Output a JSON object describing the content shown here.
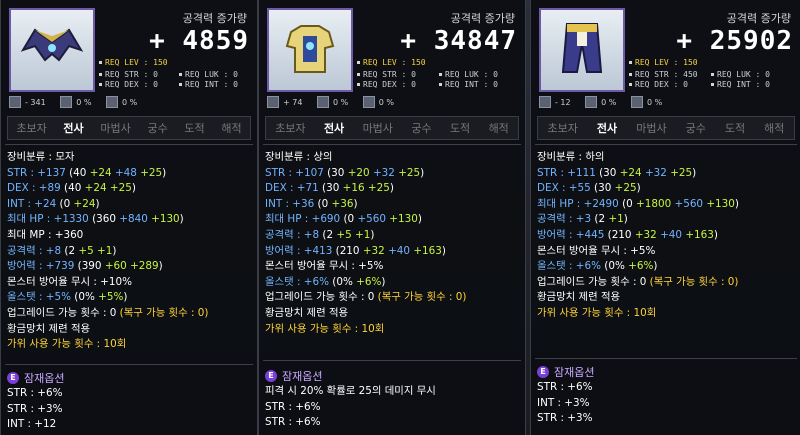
{
  "tooltips": [
    {
      "title": "공격력 증가량",
      "power": "+ 4859",
      "req": {
        "lev": "REQ LEV : 150",
        "str": "REQ STR : 0",
        "luk": "REQ LUK : 0",
        "dex": "REQ DEX : 0",
        "int": "REQ INT : 0"
      },
      "misc": [
        "- 341",
        "0 %",
        "0 %"
      ],
      "classes": [
        "초보자",
        "전사",
        "마법사",
        "궁수",
        "도적",
        "해적"
      ],
      "category": "장비분류 : 모자",
      "stats": [
        {
          "base": "STR : +137",
          "detail": "(40 ",
          "a": "+24",
          "b": " +48",
          "c": " +25",
          "end": ")"
        },
        {
          "base": "DEX : +89",
          "detail": "(40 ",
          "a": "+24",
          "b": "",
          "c": " +25",
          "end": ")"
        },
        {
          "base": "INT : +24",
          "detail": "(0 ",
          "a": "+24",
          "b": "",
          "c": "",
          "end": ")"
        },
        {
          "base": "최대 HP : +1330",
          "detail": "(360 ",
          "a": "",
          "b": "+840",
          "c": " +130",
          "end": ")"
        },
        {
          "base": "최대 MP : +360",
          "detail": "",
          "a": "",
          "b": "",
          "c": "",
          "end": ""
        },
        {
          "base": "공격력 : +8",
          "detail": "(2 ",
          "a": "+5",
          "b": "",
          "c": " +1",
          "end": ")"
        },
        {
          "base": "방어력 : +739",
          "detail": "(390 ",
          "a": "+60",
          "b": "",
          "c": " +289",
          "end": ")"
        },
        {
          "base": "몬스터 방어율 무시 : +10%",
          "detail": "",
          "a": "",
          "b": "",
          "c": "",
          "end": ""
        },
        {
          "base": "올스탯 : +5%",
          "detail": "(0% ",
          "a": "+5%",
          "b": "",
          "c": "",
          "end": ")"
        }
      ],
      "upgrade": "업그레이드 가능 횟수 : 0",
      "upgrade_restore": " (복구 가능 횟수 : 0)",
      "hammer": "황금망치 제련 적용",
      "scissors": "가위 사용 가능 횟수 : 10회",
      "potential_title": "잠재옵션",
      "potential": [
        "STR : +6%",
        "STR : +3%",
        "INT : +12"
      ]
    },
    {
      "title": "공격력 증가량",
      "power": "+ 34847",
      "req": {
        "lev": "REQ LEV : 150",
        "str": "REQ STR : 0",
        "luk": "REQ LUK : 0",
        "dex": "REQ DEX : 0",
        "int": "REQ INT : 0"
      },
      "misc": [
        "+ 74",
        "0 %",
        "0 %"
      ],
      "classes": [
        "초보자",
        "전사",
        "마법사",
        "궁수",
        "도적",
        "해적"
      ],
      "category": "장비분류 : 상의",
      "stats": [
        {
          "base": "STR : +107",
          "detail": "(30 ",
          "a": "+20",
          "b": " +32",
          "c": " +25",
          "end": ")"
        },
        {
          "base": "DEX : +71",
          "detail": "(30 ",
          "a": "+16",
          "b": "",
          "c": " +25",
          "end": ")"
        },
        {
          "base": "INT : +36",
          "detail": "(0 ",
          "a": "+36",
          "b": "",
          "c": "",
          "end": ")"
        },
        {
          "base": "최대 HP : +690",
          "detail": "(0 ",
          "a": "",
          "b": "+560",
          "c": " +130",
          "end": ")"
        },
        {
          "base": "공격력 : +8",
          "detail": "(2 ",
          "a": "+5",
          "b": "",
          "c": " +1",
          "end": ")"
        },
        {
          "base": "방어력 : +413",
          "detail": "(210 ",
          "a": "+32",
          "b": " +40",
          "c": " +163",
          "end": ")"
        },
        {
          "base": "몬스터 방어율 무시 : +5%",
          "detail": "",
          "a": "",
          "b": "",
          "c": "",
          "end": ""
        },
        {
          "base": "올스탯 : +6%",
          "detail": "(0% ",
          "a": "+6%",
          "b": "",
          "c": "",
          "end": ")"
        }
      ],
      "upgrade": "업그레이드 가능 횟수 : 0",
      "upgrade_restore": " (복구 가능 횟수 : 0)",
      "hammer": "황금망치 제련 적용",
      "scissors": "가위 사용 가능 횟수 : 10회",
      "potential_title": "잠재옵션",
      "potential": [
        "피격 시 20% 확률로 25의 데미지 무시",
        "STR : +6%",
        "STR : +6%"
      ]
    },
    {
      "title": "공격력 증가량",
      "power": "+ 25902",
      "req": {
        "lev": "REQ LEV : 150",
        "str": "REQ STR : 450",
        "luk": "REQ LUK : 0",
        "dex": "REQ DEX : 0",
        "int": "REQ INT : 0"
      },
      "misc": [
        "- 12",
        "0 %",
        "0 %"
      ],
      "classes": [
        "초보자",
        "전사",
        "마법사",
        "궁수",
        "도적",
        "해적"
      ],
      "category": "장비분류 : 하의",
      "stats": [
        {
          "base": "STR : +111",
          "detail": "(30 ",
          "a": "+24",
          "b": " +32",
          "c": " +25",
          "end": ")"
        },
        {
          "base": "DEX : +55",
          "detail": "(30 ",
          "a": "",
          "b": "",
          "c": "+25",
          "end": ")"
        },
        {
          "base": "최대 HP : +2490",
          "detail": "(0 ",
          "a": "+1800",
          "b": " +560",
          "c": " +130",
          "end": ")"
        },
        {
          "base": "공격력 : +3",
          "detail": "(2 ",
          "a": "",
          "b": "",
          "c": "+1",
          "end": ")"
        },
        {
          "base": "방어력 : +445",
          "detail": "(210 ",
          "a": "+32",
          "b": " +40",
          "c": " +163",
          "end": ")"
        },
        {
          "base": "몬스터 방어율 무시 : +5%",
          "detail": "",
          "a": "",
          "b": "",
          "c": "",
          "end": ""
        },
        {
          "base": "올스탯 : +6%",
          "detail": "(0% ",
          "a": "+6%",
          "b": "",
          "c": "",
          "end": ")"
        }
      ],
      "upgrade": "업그레이드 가능 횟수 : 0",
      "upgrade_restore": " (복구 가능 횟수 : 0)",
      "hammer": "황금망치 제련 적용",
      "scissors": "가위 사용 가능 횟수 : 10회",
      "potential_title": "잠재옵션",
      "potential": [
        "STR : +6%",
        "INT : +3%",
        "STR : +3%"
      ]
    }
  ]
}
